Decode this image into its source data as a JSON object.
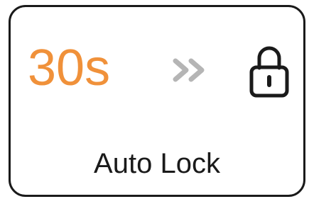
{
  "auto_lock": {
    "value": "30s",
    "label": "Auto Lock",
    "value_color": "#f0913a",
    "arrow_icon": "double-chevron-right-icon",
    "lock_icon": "padlock-icon"
  }
}
